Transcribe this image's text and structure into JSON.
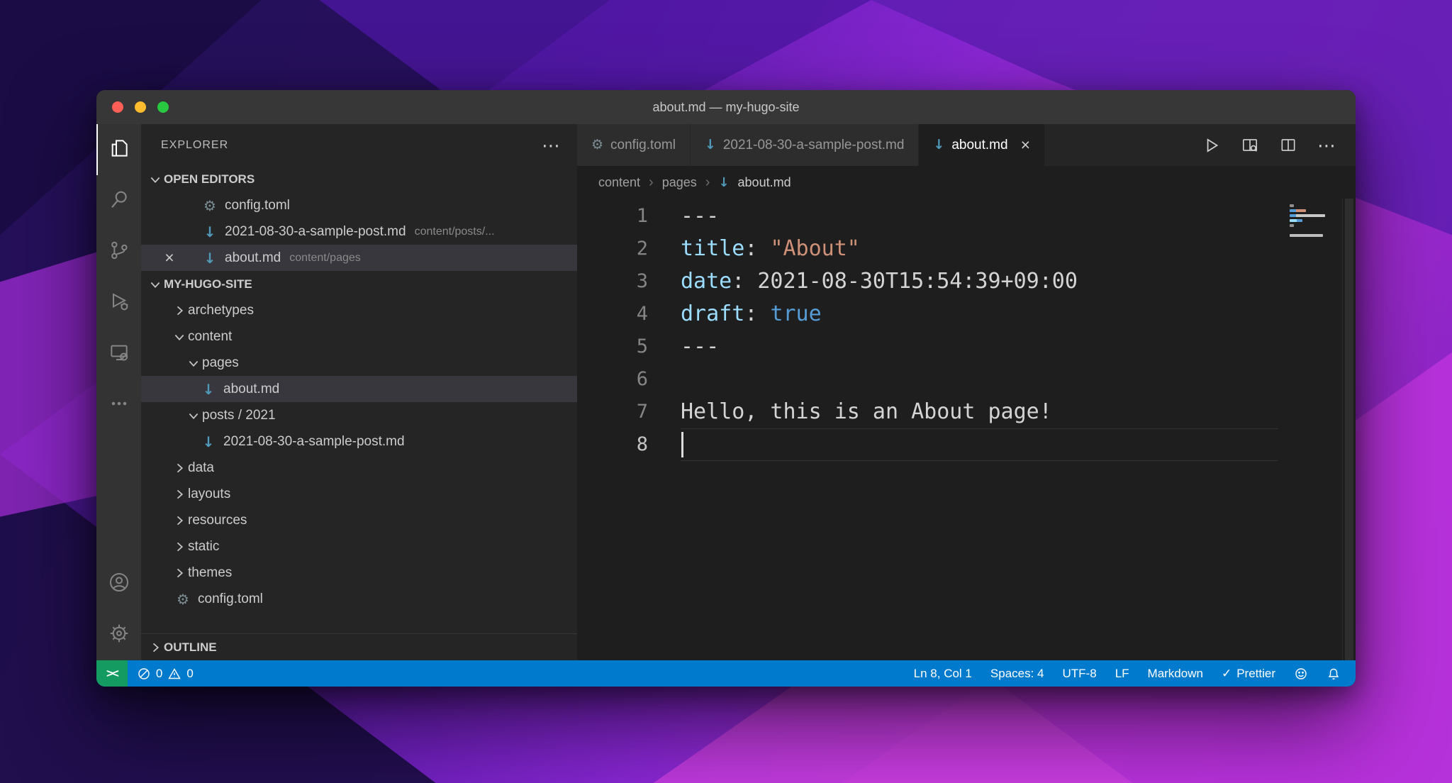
{
  "window": {
    "title": "about.md — my-hugo-site"
  },
  "glyphs": {
    "gear": "⚙",
    "markdown": "↓",
    "close": "×",
    "more": "⋯",
    "crumb_sep": "›",
    "check": "✓",
    "remote": "><"
  },
  "colors": {
    "status_bar": "#007acc",
    "remote_indicator": "#149b62",
    "markdown_icon": "#519aba",
    "titlebar": "#373737",
    "sidebar": "#252526",
    "editor": "#1e1e1e",
    "selection_row": "#37373d",
    "traffic_red": "#ff5f57",
    "traffic_yellow": "#febc2e",
    "traffic_green": "#28c840"
  },
  "sidebar": {
    "title": "EXPLORER",
    "open_editors": {
      "label": "OPEN EDITORS",
      "items": [
        {
          "name": "config.toml",
          "path": ""
        },
        {
          "name": "2021-08-30-a-sample-post.md",
          "path": "content/posts/..."
        },
        {
          "name": "about.md",
          "path": "content/pages"
        }
      ]
    },
    "tree": {
      "label": "MY-HUGO-SITE",
      "items": [
        {
          "name": "archetypes"
        },
        {
          "name": "content"
        },
        {
          "name": "pages"
        },
        {
          "name": "about.md"
        },
        {
          "name": "posts / 2021"
        },
        {
          "name": "2021-08-30-a-sample-post.md"
        },
        {
          "name": "data"
        },
        {
          "name": "layouts"
        },
        {
          "name": "resources"
        },
        {
          "name": "static"
        },
        {
          "name": "themes"
        },
        {
          "name": "config.toml"
        }
      ]
    },
    "outline": {
      "label": "OUTLINE"
    }
  },
  "tabs": [
    {
      "label": "config.toml"
    },
    {
      "label": "2021-08-30-a-sample-post.md"
    },
    {
      "label": "about.md"
    }
  ],
  "breadcrumbs": {
    "items": [
      "content",
      "pages",
      "about.md"
    ]
  },
  "editor": {
    "lines": [
      {
        "num": "1",
        "text": "---"
      },
      {
        "num": "2",
        "key": "title",
        "sep": ": ",
        "value": "\"About\""
      },
      {
        "num": "3",
        "key": "date",
        "sep": ": ",
        "value": "2021-08-30T15:54:39+09:00"
      },
      {
        "num": "4",
        "key": "draft",
        "sep": ": ",
        "value": "true"
      },
      {
        "num": "5",
        "text": "---"
      },
      {
        "num": "6",
        "text": ""
      },
      {
        "num": "7",
        "text": "Hello, this is an About page!"
      },
      {
        "num": "8",
        "text": ""
      }
    ]
  },
  "status_bar": {
    "errors": "0",
    "warnings": "0",
    "line_col": "Ln 8, Col 1",
    "spaces": "Spaces: 4",
    "encoding": "UTF-8",
    "eol": "LF",
    "language": "Markdown",
    "formatter": "Prettier"
  }
}
